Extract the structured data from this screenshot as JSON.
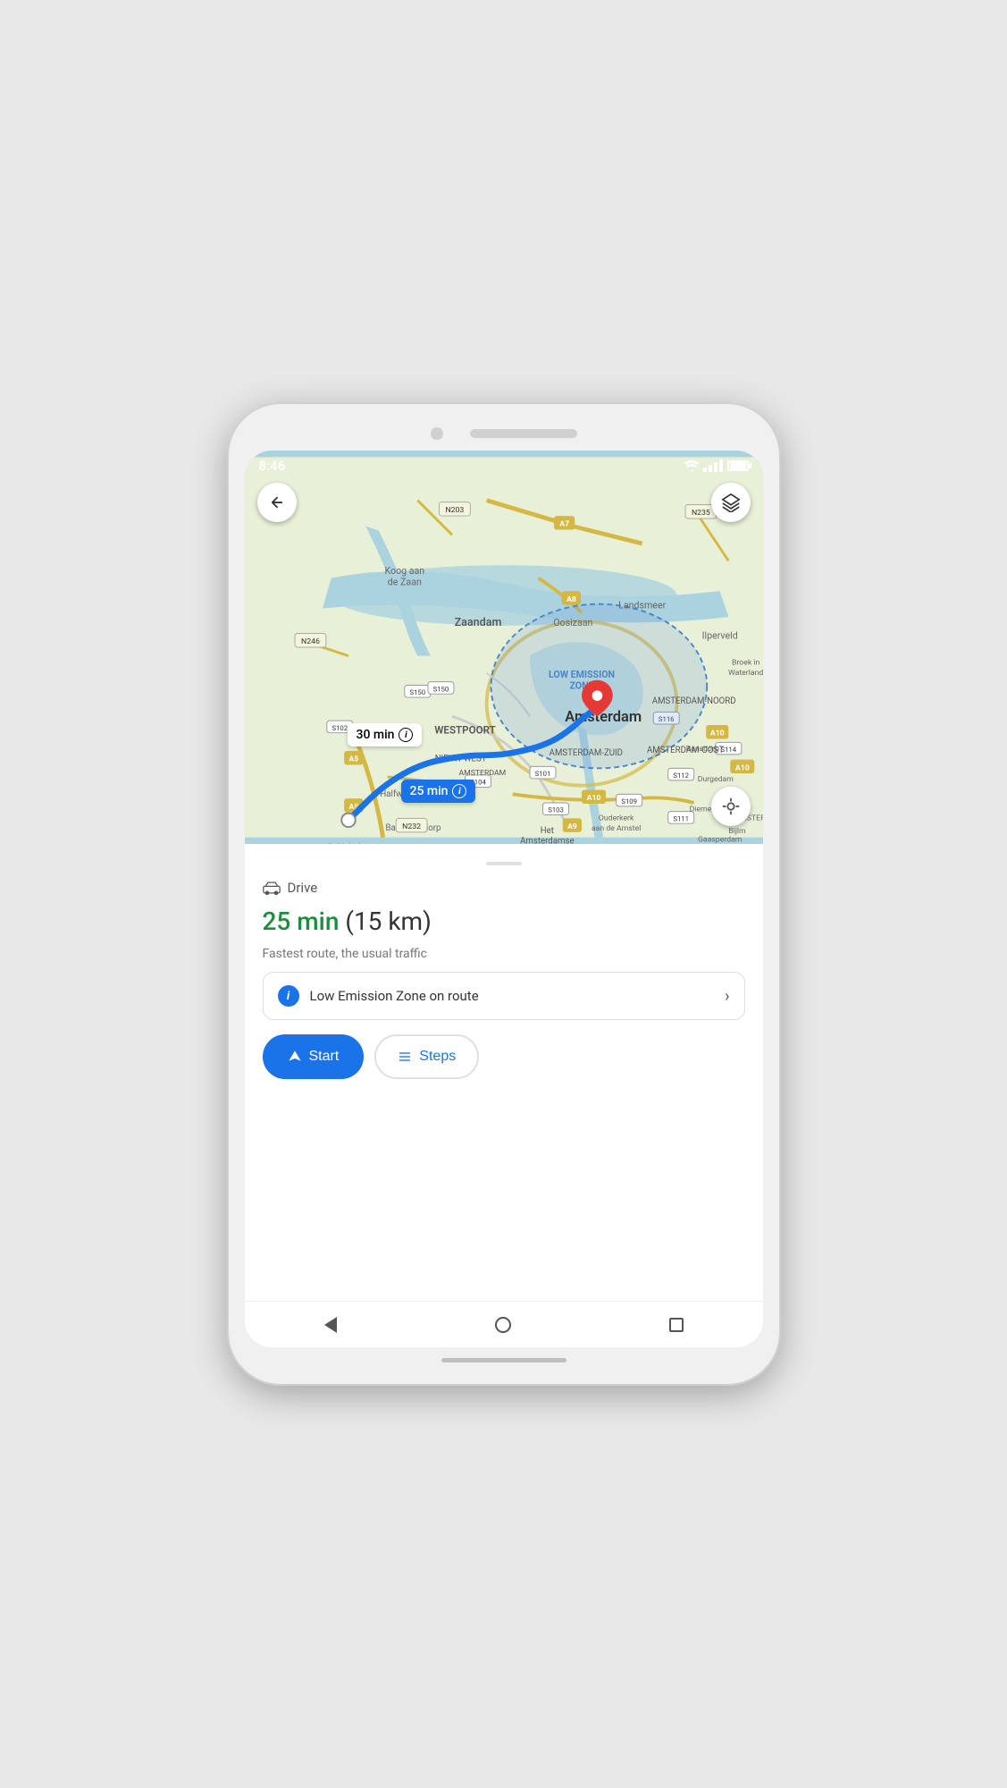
{
  "status_bar": {
    "time": "8:46"
  },
  "map": {
    "back_button_label": "Back",
    "layers_button_label": "Layers",
    "location_button_label": "My location",
    "time_bubble_1": {
      "time": "30 min",
      "selected": false
    },
    "time_bubble_2": {
      "time": "25 min",
      "selected": true
    },
    "lez_label": "LOW EMISSION ZONE"
  },
  "bottom_panel": {
    "drag_handle_label": "",
    "drive_label": "Drive",
    "time": "25 min",
    "distance": "(15 km)",
    "route_description": "Fastest route, the usual traffic",
    "lez_notice": "Low Emission Zone on route"
  },
  "buttons": {
    "start_label": "Start",
    "steps_label": "Steps"
  },
  "nav_bar": {
    "back_label": "Back",
    "home_label": "Home",
    "recents_label": "Recents"
  }
}
